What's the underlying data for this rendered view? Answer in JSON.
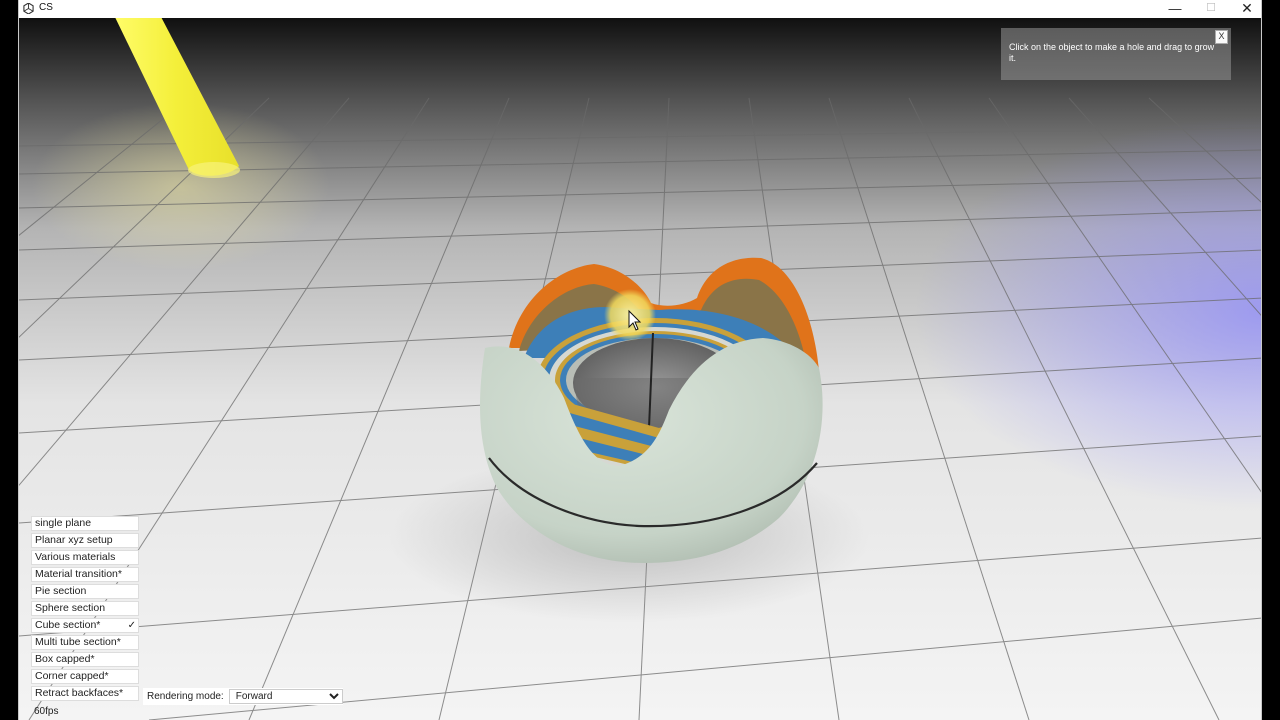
{
  "window": {
    "title": "CS",
    "minimize_glyph": "—",
    "maximize_glyph": "☐",
    "close_glyph": "✕"
  },
  "hint": {
    "text": "Click on the object to make a hole and drag to grow it.",
    "close_label": "X"
  },
  "menu": {
    "items": [
      {
        "label": "single plane",
        "checked": false
      },
      {
        "label": "Planar xyz setup",
        "checked": false
      },
      {
        "label": "Various materials",
        "checked": false
      },
      {
        "label": "Material transition*",
        "checked": false
      },
      {
        "label": "Pie section",
        "checked": false
      },
      {
        "label": "Sphere section",
        "checked": false
      },
      {
        "label": "Cube section*",
        "checked": true
      },
      {
        "label": "Multi tube section*",
        "checked": false
      },
      {
        "label": "Box capped*",
        "checked": false
      },
      {
        "label": "Corner capped*",
        "checked": false
      },
      {
        "label": "Retract backfaces*",
        "checked": false
      }
    ],
    "check_glyph": "✓"
  },
  "rendering": {
    "label": "Rendering mode:",
    "selected": "Forward"
  },
  "fps": "60fps",
  "colors": {
    "sphere": "#c9d6ca",
    "orange": "#e0731a",
    "blue": "#3d7fb8",
    "gold": "#c9a13a",
    "light_beam": "#f4ef3a",
    "cursor_highlight": "#f6e27a"
  }
}
